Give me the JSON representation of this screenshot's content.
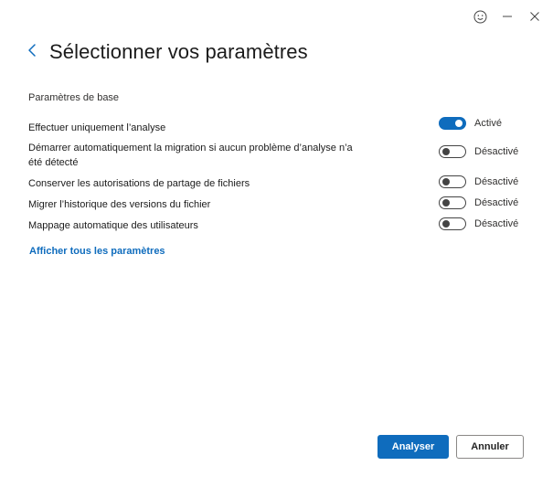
{
  "window": {
    "title": "Sélectionner vos paramètres",
    "icons": [
      "smiley-feedback-icon",
      "minimize-icon",
      "close-icon"
    ]
  },
  "section": {
    "label": "Paramètres de base"
  },
  "settings": [
    {
      "label": "Effectuer uniquement l’analyse",
      "state": "on",
      "status": "Activé"
    },
    {
      "label": "Démarrer automatiquement la migration si aucun problème d’analyse n’a été détecté",
      "state": "off",
      "status": "Désactivé"
    },
    {
      "label": "Conserver les autorisations de partage de fichiers",
      "state": "off",
      "status": "Désactivé"
    },
    {
      "label": "Migrer l’historique des versions du fichier",
      "state": "off",
      "status": "Désactivé"
    },
    {
      "label": "Mappage automatique des utilisateurs",
      "state": "off",
      "status": "Désactivé"
    }
  ],
  "link": {
    "label": "Afficher tous les paramètres"
  },
  "buttons": {
    "primary": "Analyser",
    "secondary": "Annuler"
  },
  "colors": {
    "accent": "#0f6cbd",
    "toggle_off": "#444444"
  }
}
